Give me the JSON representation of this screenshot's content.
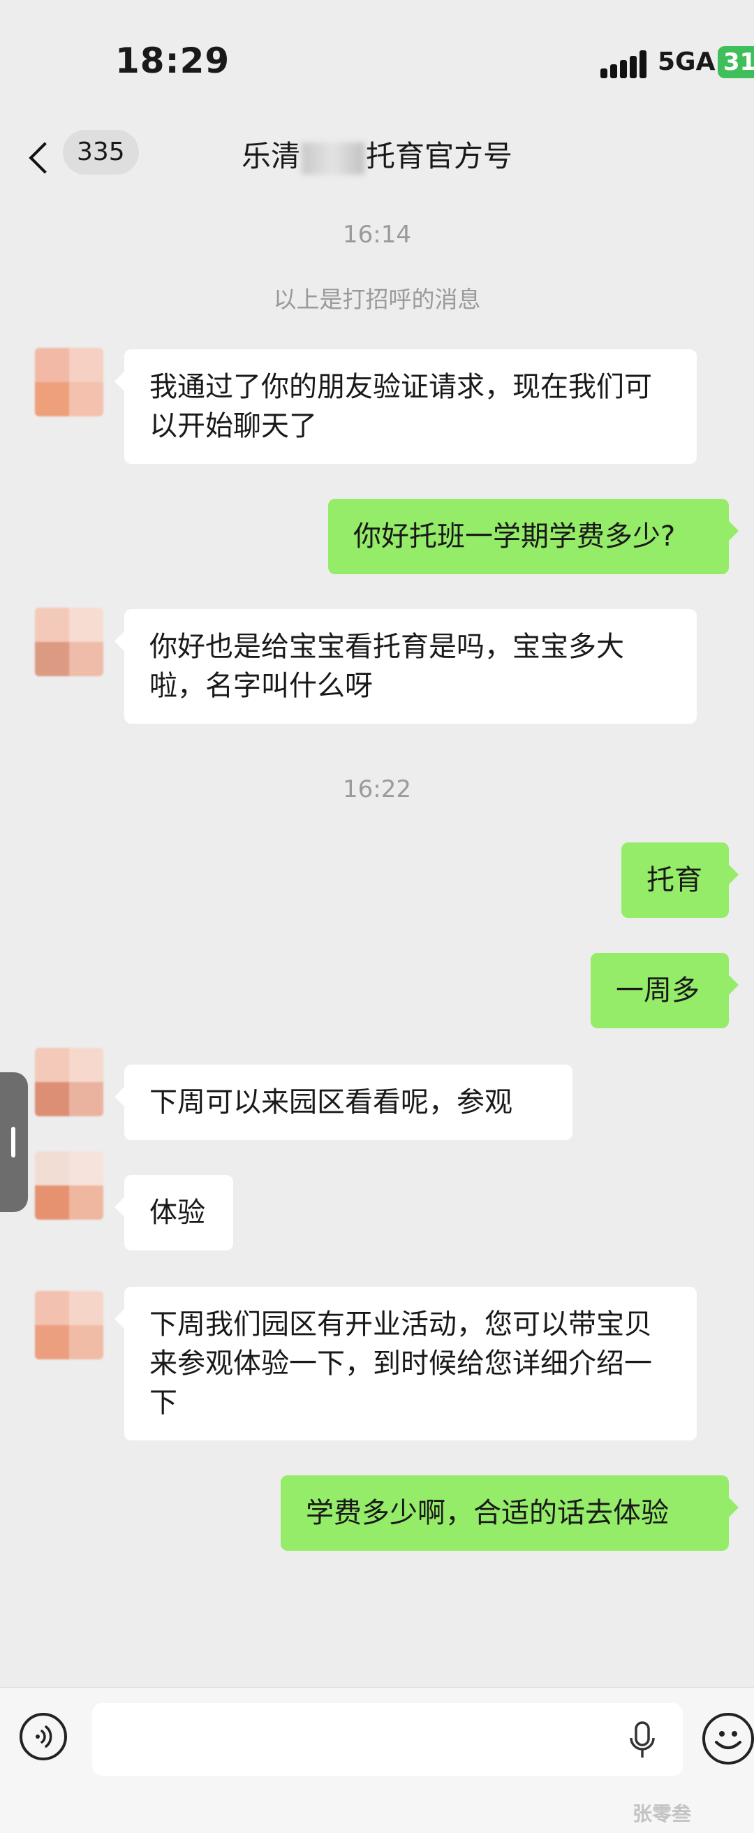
{
  "status_bar": {
    "time": "18:29",
    "network": "5GA",
    "battery": "31"
  },
  "nav": {
    "unread_count": "335",
    "title_prefix": "乐清",
    "title_suffix": "托育官方号"
  },
  "chat": {
    "timestamps": [
      "16:14",
      "16:22"
    ],
    "system_notice": "以上是打招呼的消息",
    "messages": [
      {
        "side": "in",
        "text": "我通过了你的朋友验证请求，现在我们可以开始聊天了"
      },
      {
        "side": "out",
        "text": "你好托班一学期学费多少?"
      },
      {
        "side": "in",
        "text": "你好也是给宝宝看托育是吗，宝宝多大啦，名字叫什么呀"
      },
      {
        "side": "out",
        "text": "托育"
      },
      {
        "side": "out",
        "text": "一周多"
      },
      {
        "side": "in",
        "text": "下周可以来园区看看呢，参观"
      },
      {
        "side": "in",
        "text": "体验"
      },
      {
        "side": "in",
        "text": "下周我们园区有开业活动，您可以带宝贝来参观体验一下，到时候给您详细介绍一下"
      },
      {
        "side": "out",
        "text": "学费多少啊，合适的话去体验"
      }
    ]
  },
  "input_bar": {
    "voice_icon": "voice-icon",
    "mic_icon": "mic-icon",
    "emoji_icon": "emoji-icon"
  },
  "watermark": "张零叁",
  "colors": {
    "background": "#ededed",
    "incoming_bubble": "#ffffff",
    "outgoing_bubble": "#95ec69",
    "timestamp_text": "#9a9a9a"
  }
}
